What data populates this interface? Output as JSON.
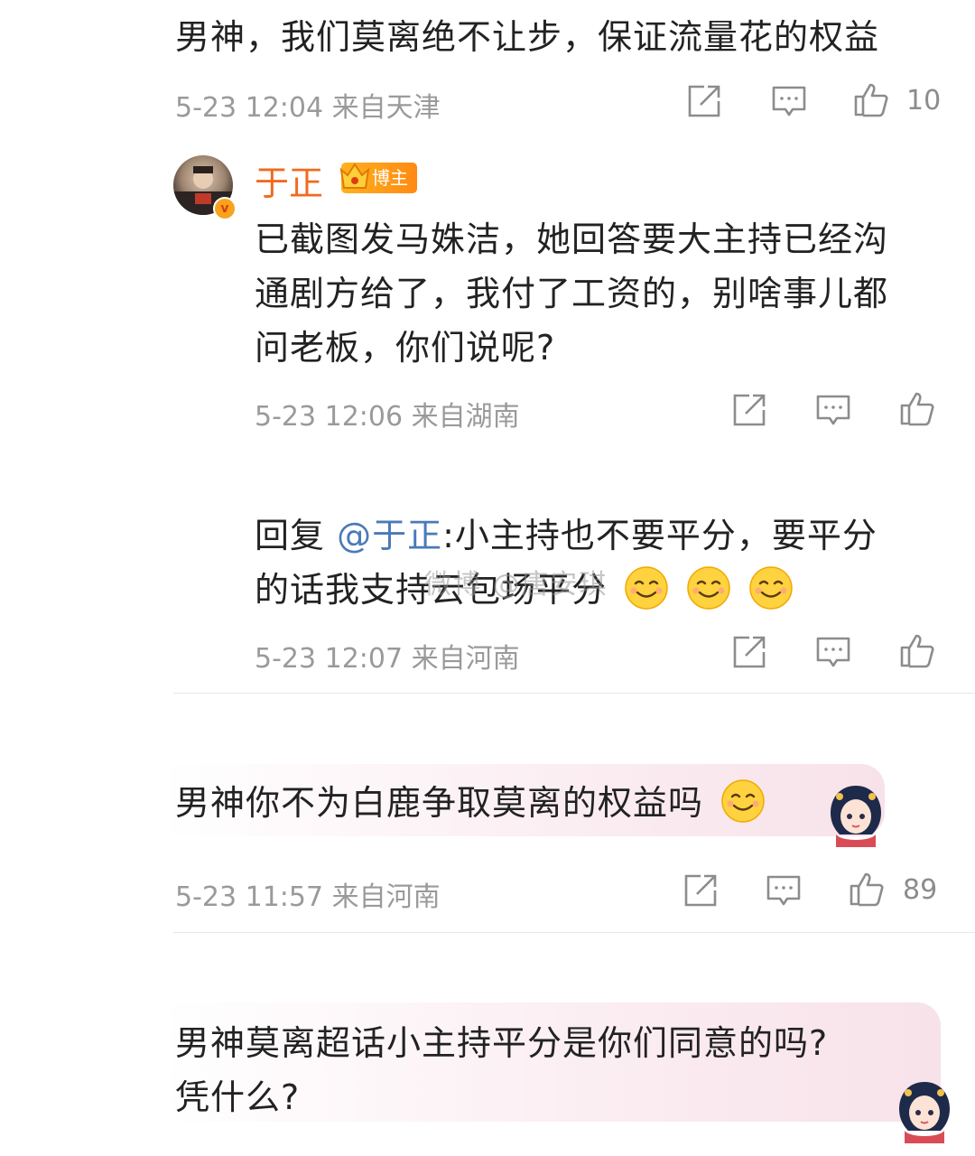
{
  "comment1": {
    "text": "男神，我们莫离绝不让步，保证流量花的权益",
    "meta": "5-23 12:04  来自天津",
    "likes": "10"
  },
  "reply_blogger": {
    "username": "于正",
    "badge": "博主",
    "verify_mark": "v",
    "lines": [
      "已截图发马姝洁，她回答要大主持已经沟",
      "通剧方给了，我付了工资的，别啥事儿都",
      "问老板，你们说呢?"
    ],
    "meta": "5-23 12:06  来自湖南"
  },
  "reply_fan": {
    "prefix": "回复 ",
    "mention": "@于正",
    "line1": ":小主持也不要平分，要平分",
    "line2": "的话我支持云包场平分",
    "meta": "5-23 12:07  来自河南"
  },
  "comment2": {
    "text": "男神你不为白鹿争取莫离的权益吗",
    "meta": "5-23 11:57  来自河南",
    "likes": "89"
  },
  "comment3": {
    "line1": "男神莫离超话小主持平分是你们同意的吗?",
    "line2": "凭什么?"
  },
  "watermark": "微博 @唐安琪",
  "icons": {
    "share": "share-icon",
    "comment": "comment-icon",
    "like": "thumbs-up-icon",
    "smiley": "smiley-emoji-icon"
  },
  "colors": {
    "username": "#f06a1e",
    "mention": "#4a7ab8",
    "badge": "#ff9a16",
    "meta": "#9a9a9a"
  }
}
